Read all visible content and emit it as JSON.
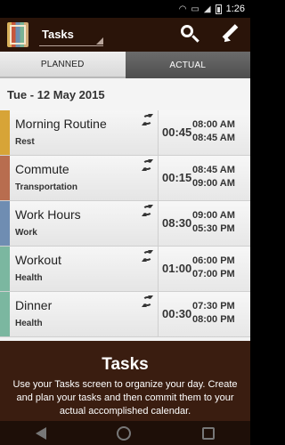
{
  "status_bar": {
    "time": "1:26",
    "icons": [
      "wifi-icon",
      "no-sim-icon",
      "signal-icon",
      "battery-icon"
    ]
  },
  "app_bar": {
    "logo_icon": "app-logo-icon",
    "selector_label": "Tasks",
    "actions": [
      "search-icon",
      "edit-icon"
    ],
    "background": "#2a1409"
  },
  "tabs": [
    {
      "label": "PLANNED",
      "active": true
    },
    {
      "label": "ACTUAL",
      "active": false
    }
  ],
  "date_header": "Tue - 12 May 2015",
  "tasks": [
    {
      "name": "Morning Routine",
      "category": "Rest",
      "duration": "00:45",
      "start": "08:00 AM",
      "end": "08:45 AM",
      "color": "#d7a437"
    },
    {
      "name": "Commute",
      "category": "Transportation",
      "duration": "00:15",
      "start": "08:45 AM",
      "end": "09:00 AM",
      "color": "#b86d4f"
    },
    {
      "name": "Work Hours",
      "category": "Work",
      "duration": "08:30",
      "start": "09:00 AM",
      "end": "05:30 PM",
      "color": "#6f8db2"
    },
    {
      "name": "Workout",
      "category": "Health",
      "duration": "01:00",
      "start": "06:00 PM",
      "end": "07:00 PM",
      "color": "#7bb7a0"
    },
    {
      "name": "Dinner",
      "category": "Health",
      "duration": "00:30",
      "start": "07:30 PM",
      "end": "08:00 PM",
      "color": "#7bb7a0"
    }
  ],
  "info": {
    "title": "Tasks",
    "text": "Use your Tasks screen to organize your day. Create and plan your tasks and then commit them to your actual accomplished calendar."
  },
  "nav_bar": {
    "icons": [
      "back-icon",
      "home-icon",
      "recent-apps-icon"
    ]
  }
}
